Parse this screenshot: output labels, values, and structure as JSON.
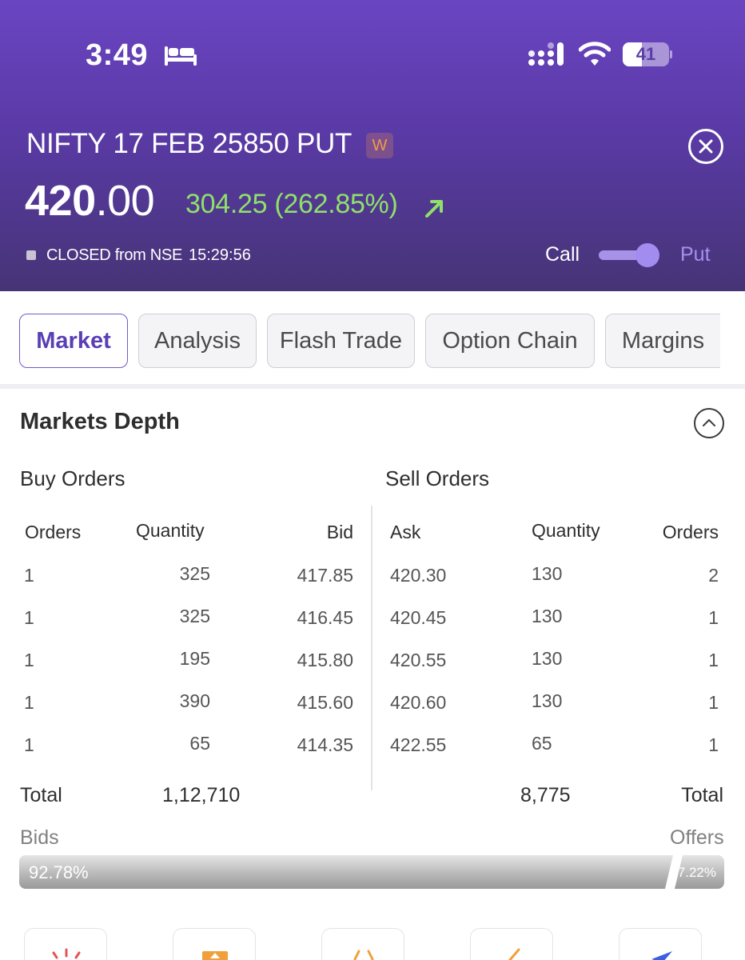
{
  "status_bar": {
    "time": "3:49",
    "battery": "41",
    "battery_level": 0.41
  },
  "instrument": {
    "title": "NIFTY 17 FEB 25850 PUT",
    "badge": "W",
    "ltp_int": "420",
    "ltp_dec": ".00",
    "change": "304.25 (262.85%)",
    "market_status": "CLOSED from NSE",
    "status_time": "15:29:56",
    "toggle_left": "Call",
    "toggle_right": "Put",
    "toggle_selected": "Put"
  },
  "tabs": [
    {
      "label": "Market",
      "active": true
    },
    {
      "label": "Analysis",
      "active": false
    },
    {
      "label": "Flash Trade",
      "active": false
    },
    {
      "label": "Option Chain",
      "active": false
    },
    {
      "label": "Margins",
      "active": false
    }
  ],
  "depth": {
    "title": "Markets Depth",
    "buy_title": "Buy Orders",
    "sell_title": "Sell Orders",
    "buy_headers": {
      "orders": "Orders",
      "quantity": "Quantity",
      "bid": "Bid"
    },
    "sell_headers": {
      "ask": "Ask",
      "quantity": "Quantity",
      "orders": "Orders"
    },
    "buy_rows": [
      {
        "orders": "1",
        "quantity": "325",
        "bid": "417.85"
      },
      {
        "orders": "1",
        "quantity": "325",
        "bid": "416.45"
      },
      {
        "orders": "1",
        "quantity": "195",
        "bid": "415.80"
      },
      {
        "orders": "1",
        "quantity": "390",
        "bid": "415.60"
      },
      {
        "orders": "1",
        "quantity": "65",
        "bid": "414.35"
      }
    ],
    "sell_rows": [
      {
        "ask": "420.30",
        "quantity": "130",
        "orders": "2"
      },
      {
        "ask": "420.45",
        "quantity": "130",
        "orders": "1"
      },
      {
        "ask": "420.55",
        "quantity": "130",
        "orders": "1"
      },
      {
        "ask": "420.60",
        "quantity": "130",
        "orders": "1"
      },
      {
        "ask": "422.55",
        "quantity": "65",
        "orders": "1"
      }
    ],
    "total_label": "Total",
    "buy_total": "1,12,710",
    "sell_total": "8,775",
    "bids_label": "Bids",
    "offers_label": "Offers",
    "bids_pct": "92.78%",
    "offers_pct": "7.22%",
    "bids_fraction": 0.9278
  },
  "colors": {
    "header_top": "#6a45c2",
    "header_bottom": "#463476",
    "positive": "#8fe06a",
    "accent": "#5a3fb4"
  }
}
